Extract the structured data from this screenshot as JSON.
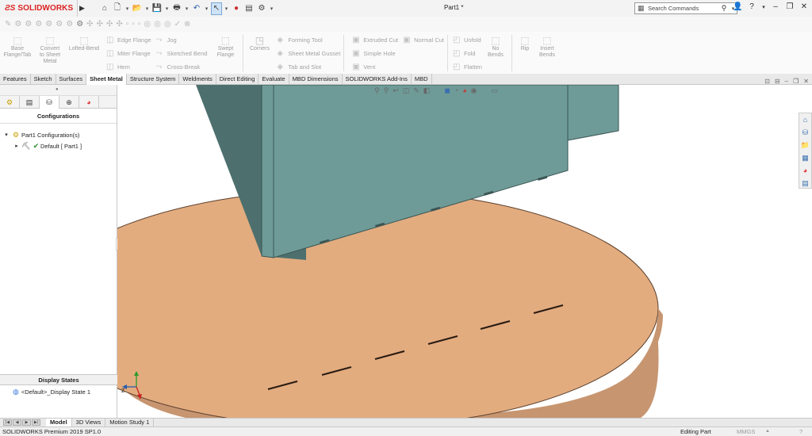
{
  "app": {
    "logo_text": "SOLIDWORKS",
    "doc_title": "Part1 *"
  },
  "search": {
    "placeholder": "Search Commands"
  },
  "ribbon": {
    "base_flange": "Base Flange/Tab",
    "convert": "Convert to Sheet Metal",
    "lofted_bend": "Lofted-Bend",
    "edge_flange": "Edge Flange",
    "miter_flange": "Miter Flange",
    "hem": "Hem",
    "jog": "Jog",
    "sketched_bend": "Sketched Bend",
    "cross_break": "Cross-Break",
    "swept_flange": "Swept Flange",
    "corners": "Corners",
    "forming_tool": "Forming Tool",
    "gusset": "Sheet Metal Gusset",
    "tab_slot": "Tab and Slot",
    "extruded_cut": "Extruded Cut",
    "simple_hole": "Simple Hole",
    "vent": "Vent",
    "normal_cut": "Normal Cut",
    "unfold": "Unfold",
    "fold": "Fold",
    "flatten": "Flatten",
    "no_bends": "No Bends",
    "rip": "Rip",
    "insert_bends": "Insert Bends"
  },
  "tabs": [
    "Features",
    "Sketch",
    "Surfaces",
    "Sheet Metal",
    "Structure System",
    "Weldments",
    "Direct Editing",
    "Evaluate",
    "MBD Dimensions",
    "SOLIDWORKS Add-Ins",
    "MBD"
  ],
  "left_panel": {
    "heading": "Configurations",
    "tree": {
      "root": "Part1 Configuration(s)",
      "child": "Default [ Part1 ]"
    },
    "display_states_heading": "Display States",
    "display_state": "<Default>_Display State 1"
  },
  "bottom_tabs": [
    "Model",
    "3D Views",
    "Motion Study 1"
  ],
  "status": {
    "app_version": "SOLIDWORKS Premium 2019 SP1.0",
    "mode": "Editing Part",
    "units": "MMGS",
    "help": "?"
  },
  "colors": {
    "plate": "#e3ac7f",
    "plate_edge": "#c79570",
    "wall_front": "#6e9b98",
    "wall_side": "#4d706e",
    "brand_red": "#d22222"
  }
}
